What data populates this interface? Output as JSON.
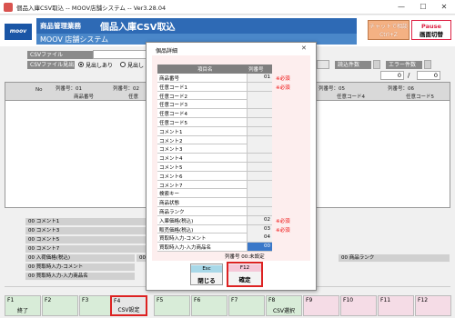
{
  "window": {
    "title": "個品入庫CSV取込 -- MOOV店舗システム -- Ver3.28.04",
    "min": "—",
    "max": "☐",
    "close": "✕"
  },
  "header": {
    "logo": "moov",
    "category": "商品管理業務",
    "screen_title": "個品入庫CSV取込",
    "system_name": "MOOV 店舗システム",
    "chat_line1": "チャットで相談",
    "chat_line2": "Ctrl+Z",
    "pause_line1": "Pause",
    "pause_line2": "画面切替"
  },
  "form": {
    "csv_file_label": "CSVファイル",
    "csv_heading_label": "CSVファイル見出",
    "radio_on": "見出しあり",
    "radio_off": "見出し",
    "read_count_label": "読込件数",
    "error_count_label": "エラー件数",
    "read_count": "0",
    "error_count": "0",
    "slash": "/"
  },
  "grid": {
    "no_header": "No",
    "cols": [
      {
        "code": "列番号：01",
        "name": "商品番号"
      },
      {
        "code": "列番号：02",
        "name": "任意"
      },
      {
        "code": "列番号：05",
        "name": "任意コード4"
      },
      {
        "code": "列番号：06",
        "name": "任意コード5"
      }
    ],
    "comments": [
      "00 コメント1",
      "00 コメント3",
      "00 コメント5",
      "00 コメント7",
      "00 入荷価格(税込)",
      "00 買取時入力-コメント",
      "00 買取時入力-入力商品名"
    ],
    "right_label_1": "00 商",
    "right_label_2": "00 商品ランク"
  },
  "dialog": {
    "title": "個品詳細",
    "close": "✕",
    "col_item": "項目名",
    "col_code": "列番号",
    "rows": [
      {
        "name": "商品番号",
        "code": "01",
        "req": "※必須"
      },
      {
        "name": "任意コード1",
        "code": "",
        "req": "※必須"
      },
      {
        "name": "任意コード2",
        "code": "",
        "req": ""
      },
      {
        "name": "任意コード3",
        "code": "",
        "req": ""
      },
      {
        "name": "任意コード4",
        "code": "",
        "req": ""
      },
      {
        "name": "任意コード5",
        "code": "",
        "req": ""
      },
      {
        "name": "コメント1",
        "code": "",
        "req": ""
      },
      {
        "name": "コメント2",
        "code": "",
        "req": ""
      },
      {
        "name": "コメント3",
        "code": "",
        "req": ""
      },
      {
        "name": "コメント4",
        "code": "",
        "req": ""
      },
      {
        "name": "コメント5",
        "code": "",
        "req": ""
      },
      {
        "name": "コメント6",
        "code": "",
        "req": ""
      },
      {
        "name": "コメント7",
        "code": "",
        "req": ""
      },
      {
        "name": "検索キー",
        "code": "",
        "req": ""
      },
      {
        "name": "商品状態",
        "code": "",
        "req": ""
      },
      {
        "name": "商品ランク",
        "code": "",
        "req": ""
      },
      {
        "name": "入庫価格(税込)",
        "code": "02",
        "req": "※必須"
      },
      {
        "name": "販売価格(税込)",
        "code": "03",
        "req": "※必須"
      },
      {
        "name": "買取時入力-コメント",
        "code": "04",
        "req": ""
      },
      {
        "name": "買取時入力-入力商品名",
        "code": "00",
        "req": ""
      }
    ],
    "note": "列番号 00:未設定",
    "esc_key": "Esc",
    "esc_label": "閉じる",
    "f12_key": "F12",
    "f12_label": "確定"
  },
  "fkeys": [
    {
      "key": "F1",
      "label": "終了"
    },
    {
      "key": "F2",
      "label": ""
    },
    {
      "key": "F3",
      "label": ""
    },
    {
      "key": "F4",
      "label": "CSV設定"
    },
    {
      "key": "F5",
      "label": ""
    },
    {
      "key": "F6",
      "label": ""
    },
    {
      "key": "F7",
      "label": ""
    },
    {
      "key": "F8",
      "label": "CSV選択"
    },
    {
      "key": "F9",
      "label": ""
    },
    {
      "key": "F10",
      "label": ""
    },
    {
      "key": "F11",
      "label": ""
    },
    {
      "key": "F12",
      "label": ""
    }
  ]
}
